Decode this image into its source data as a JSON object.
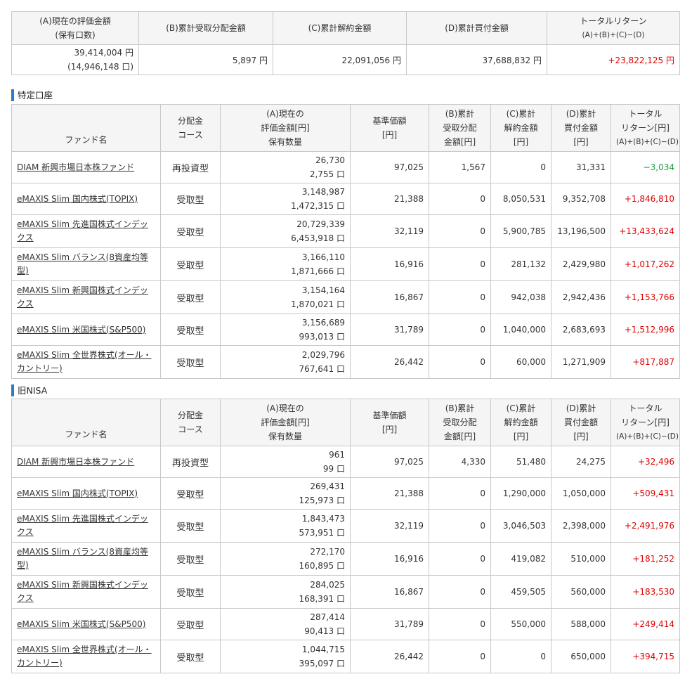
{
  "summary": {
    "headers": {
      "a": [
        "(A)現在の評価金額",
        "(保有口数)"
      ],
      "b": "(B)累計受取分配金額",
      "c": "(C)累計解約金額",
      "d": "(D)累計買付金額",
      "e": [
        "トータルリターン",
        "(A)+(B)+(C)−(D)"
      ]
    },
    "values": {
      "a_amount": "39,414,004 円",
      "a_units": "(14,946,148 口)",
      "b": "5,897 円",
      "c": "22,091,056 円",
      "d": "37,688,832 円",
      "e": "+23,822,125 円"
    }
  },
  "sections": {
    "tokutei": {
      "title": "特定口座",
      "headers": {
        "name": "ファンド名",
        "course": [
          "分配金",
          "コース"
        ],
        "valuation": [
          "(A)現在の",
          "評価金額[円]",
          "保有数量"
        ],
        "nav": [
          "基準価額",
          "[円]"
        ],
        "dist": [
          "(B)累計",
          "受取分配",
          "金額[円]"
        ],
        "cancel": [
          "(C)累計",
          "解約金額",
          "[円]"
        ],
        "buy": [
          "(D)累計",
          "買付金額",
          "[円]"
        ],
        "total": [
          "トータル",
          "リターン[円]",
          "(A)+(B)+(C)−(D)"
        ]
      },
      "rows": [
        {
          "name": "DIAM 新興市場日本株ファンド",
          "course": "再投資型",
          "valuation": "26,730",
          "units": "2,755 口",
          "nav": "97,025",
          "dist": "1,567",
          "cancel": "0",
          "buy": "31,331",
          "total": "−3,034"
        },
        {
          "name": "eMAXIS Slim 国内株式(TOPIX)",
          "course": "受取型",
          "valuation": "3,148,987",
          "units": "1,472,315 口",
          "nav": "21,388",
          "dist": "0",
          "cancel": "8,050,531",
          "buy": "9,352,708",
          "total": "+1,846,810"
        },
        {
          "name": "eMAXIS Slim 先進国株式インデックス",
          "course": "受取型",
          "valuation": "20,729,339",
          "units": "6,453,918 口",
          "nav": "32,119",
          "dist": "0",
          "cancel": "5,900,785",
          "buy": "13,196,500",
          "total": "+13,433,624"
        },
        {
          "name": "eMAXIS Slim バランス(8資産均等型)",
          "course": "受取型",
          "valuation": "3,166,110",
          "units": "1,871,666 口",
          "nav": "16,916",
          "dist": "0",
          "cancel": "281,132",
          "buy": "2,429,980",
          "total": "+1,017,262"
        },
        {
          "name": "eMAXIS Slim 新興国株式インデックス",
          "course": "受取型",
          "valuation": "3,154,164",
          "units": "1,870,021 口",
          "nav": "16,867",
          "dist": "0",
          "cancel": "942,038",
          "buy": "2,942,436",
          "total": "+1,153,766"
        },
        {
          "name": "eMAXIS Slim 米国株式(S&P500)",
          "course": "受取型",
          "valuation": "3,156,689",
          "units": "993,013 口",
          "nav": "31,789",
          "dist": "0",
          "cancel": "1,040,000",
          "buy": "2,683,693",
          "total": "+1,512,996"
        },
        {
          "name": "eMAXIS Slim 全世界株式(オール・カントリー)",
          "course": "受取型",
          "valuation": "2,029,796",
          "units": "767,641 口",
          "nav": "26,442",
          "dist": "0",
          "cancel": "60,000",
          "buy": "1,271,909",
          "total": "+817,887"
        }
      ]
    },
    "nisa": {
      "title": "旧NISA",
      "headers": {
        "name": "ファンド名",
        "course": [
          "分配金",
          "コース"
        ],
        "valuation": [
          "(A)現在の",
          "評価金額[円]",
          "保有数量"
        ],
        "nav": [
          "基準価額",
          "[円]"
        ],
        "dist": [
          "(B)累計",
          "受取分配",
          "金額[円]"
        ],
        "cancel": [
          "(C)累計",
          "解約金額",
          "[円]"
        ],
        "buy": [
          "(D)累計",
          "買付金額",
          "[円]"
        ],
        "total": [
          "トータル",
          "リターン[円]",
          "(A)+(B)+(C)−(D)"
        ]
      },
      "rows": [
        {
          "name": "DIAM 新興市場日本株ファンド",
          "course": "再投資型",
          "valuation": "961",
          "units": "99 口",
          "nav": "97,025",
          "dist": "4,330",
          "cancel": "51,480",
          "buy": "24,275",
          "total": "+32,496"
        },
        {
          "name": "eMAXIS Slim 国内株式(TOPIX)",
          "course": "受取型",
          "valuation": "269,431",
          "units": "125,973 口",
          "nav": "21,388",
          "dist": "0",
          "cancel": "1,290,000",
          "buy": "1,050,000",
          "total": "+509,431"
        },
        {
          "name": "eMAXIS Slim 先進国株式インデックス",
          "course": "受取型",
          "valuation": "1,843,473",
          "units": "573,951 口",
          "nav": "32,119",
          "dist": "0",
          "cancel": "3,046,503",
          "buy": "2,398,000",
          "total": "+2,491,976"
        },
        {
          "name": "eMAXIS Slim バランス(8資産均等型)",
          "course": "受取型",
          "valuation": "272,170",
          "units": "160,895 口",
          "nav": "16,916",
          "dist": "0",
          "cancel": "419,082",
          "buy": "510,000",
          "total": "+181,252"
        },
        {
          "name": "eMAXIS Slim 新興国株式インデックス",
          "course": "受取型",
          "valuation": "284,025",
          "units": "168,391 口",
          "nav": "16,867",
          "dist": "0",
          "cancel": "459,505",
          "buy": "560,000",
          "total": "+183,530"
        },
        {
          "name": "eMAXIS Slim 米国株式(S&P500)",
          "course": "受取型",
          "valuation": "287,414",
          "units": "90,413 口",
          "nav": "31,789",
          "dist": "0",
          "cancel": "550,000",
          "buy": "588,000",
          "total": "+249,414"
        },
        {
          "name": "eMAXIS Slim 全世界株式(オール・カントリー)",
          "course": "受取型",
          "valuation": "1,044,715",
          "units": "395,097 口",
          "nav": "26,442",
          "dist": "0",
          "cancel": "0",
          "buy": "650,000",
          "total": "+394,715"
        }
      ]
    }
  },
  "colors": {
    "negative": "#1e9e3a",
    "positive": "#e00000",
    "section_marker": "#2d7cc8"
  }
}
